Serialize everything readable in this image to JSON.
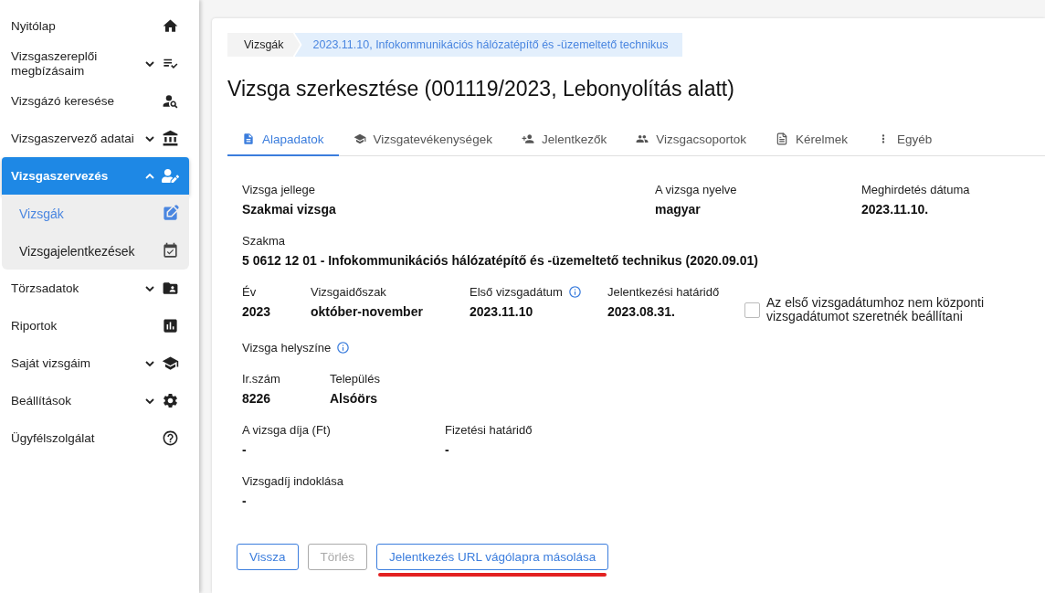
{
  "sidebar": {
    "items": [
      {
        "label": "Nyitólap",
        "kind": "link",
        "selected": false
      },
      {
        "label": "Vizsgaszereplői megbízásaim",
        "kind": "group",
        "expanded": false,
        "selected": false
      },
      {
        "label": "Vizsgázó keresése",
        "kind": "link",
        "selected": false
      },
      {
        "label": "Vizsgaszervező adatai",
        "kind": "group",
        "expanded": false,
        "selected": false
      },
      {
        "label": "Vizsgaszervezés",
        "kind": "group",
        "expanded": true,
        "selected": true,
        "children": [
          {
            "label": "Vizsgák",
            "selected": true
          },
          {
            "label": "Vizsgajelentkezések",
            "selected": false
          }
        ]
      },
      {
        "label": "Törzsadatok",
        "kind": "group",
        "expanded": false,
        "selected": false
      },
      {
        "label": "Riportok",
        "kind": "link",
        "selected": false
      },
      {
        "label": "Saját vizsgáim",
        "kind": "group",
        "expanded": false,
        "selected": false
      },
      {
        "label": "Beállítások",
        "kind": "group",
        "expanded": false,
        "selected": false
      },
      {
        "label": "Ügyfélszolgálat",
        "kind": "link",
        "selected": false
      }
    ]
  },
  "breadcrumb": [
    "Vizsgák",
    "2023.11.10, Infokommunikációs hálózatépítő és -üzemeltető technikus"
  ],
  "title": "Vizsga szerkesztése (001119/2023, Lebonyolítás alatt)",
  "tabs": [
    {
      "label": "Alapadatok",
      "selected": true
    },
    {
      "label": "Vizsgatevékenységek",
      "selected": false
    },
    {
      "label": "Jelentkezők",
      "selected": false
    },
    {
      "label": "Vizsgacsoportok",
      "selected": false
    },
    {
      "label": "Kérelmek",
      "selected": false
    },
    {
      "label": "Egyéb",
      "selected": false
    }
  ],
  "field_rows": [
    [
      {
        "label": "Vizsga jellege",
        "value": "Szakmai vizsga"
      },
      {
        "label": "A vizsga nyelve",
        "value": "magyar"
      },
      {
        "label": "Meghirdetés dátuma",
        "value": "2023.11.10."
      }
    ],
    [
      {
        "label": "Szakma",
        "value": "5 0612 12 01 - Infokommunikációs hálózatépítő és -üzemeltető technikus (2020.09.01)"
      }
    ],
    [
      {
        "label": "Év",
        "value": "2023"
      },
      {
        "label": "Vizsgaidőszak",
        "value": "október-november"
      },
      {
        "label": "Első vizsgadátum",
        "value": "2023.11.10",
        "info": true
      },
      {
        "label": "Jelentkezési határidő",
        "value": "2023.08.31."
      }
    ],
    [
      {
        "label": "Vizsga helyszíne",
        "info": true
      }
    ],
    [
      {
        "label": "Ir.szám",
        "value": "8226"
      },
      {
        "label": "Település",
        "value": "Alsóörs"
      }
    ],
    [
      {
        "label": "A vizsga díja (Ft)",
        "value": "-"
      },
      {
        "label": "Fizetési határidő",
        "value": "-"
      }
    ],
    [
      {
        "label": "Vizsgadíj indoklása",
        "value": "-"
      }
    ]
  ],
  "central_date_checkbox": {
    "label": "Az első vizsgadátumhoz nem központi vizsgadátumot szeretnék beállítani",
    "checked": false
  },
  "buttons": [
    {
      "label": "Vissza",
      "disabled": false,
      "underlined": false
    },
    {
      "label": "Törlés",
      "disabled": true,
      "underlined": false
    },
    {
      "label": "Jelentkezés URL vágólapra másolása",
      "disabled": false,
      "underlined": true
    }
  ]
}
